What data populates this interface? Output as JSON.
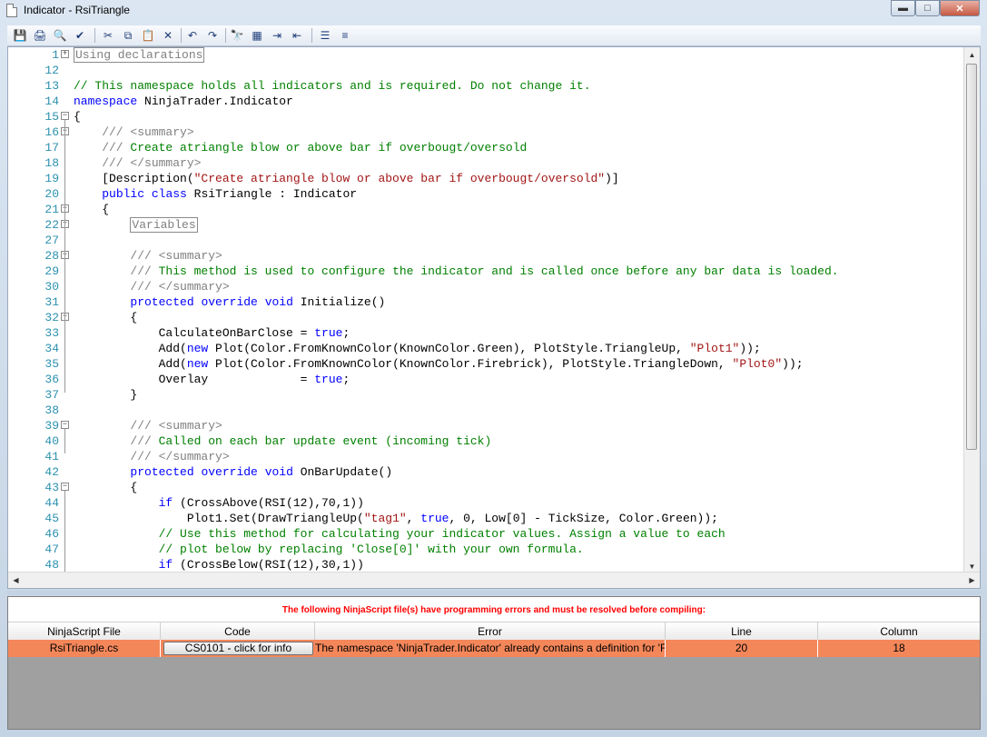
{
  "window": {
    "title": "Indicator - RsiTriangle",
    "controls": {
      "minimize": "▬",
      "maximize": "□",
      "close": "✕"
    }
  },
  "toolbar": {
    "icons": [
      "save-icon",
      "print-icon",
      "print-preview-icon",
      "compile-icon",
      "cut-icon",
      "copy-icon",
      "paste-icon",
      "delete-icon",
      "undo-icon",
      "redo-icon",
      "find-icon",
      "find-replace-icon",
      "indent-icon",
      "outdent-icon",
      "comment-icon",
      "uncomment-icon"
    ],
    "glyphs": [
      "💾",
      "🖨",
      "🔍",
      "✔",
      "✂",
      "⧉",
      "📋",
      "✕",
      "↶",
      "↷",
      "🔭",
      "▦",
      "⇥",
      "⇤",
      "☰",
      "≡"
    ]
  },
  "editor": {
    "lines": [
      {
        "num": "1",
        "fold": "plus"
      },
      {
        "num": "12"
      },
      {
        "num": "13"
      },
      {
        "num": "14"
      },
      {
        "num": "15",
        "fold": "minus"
      },
      {
        "num": "16",
        "fold": "minus"
      },
      {
        "num": "17"
      },
      {
        "num": "18",
        "fold": "end"
      },
      {
        "num": "19"
      },
      {
        "num": "20"
      },
      {
        "num": "21",
        "fold": "minus"
      },
      {
        "num": "22",
        "fold": "plus"
      },
      {
        "num": "27"
      },
      {
        "num": "28",
        "fold": "minus"
      },
      {
        "num": "29"
      },
      {
        "num": "30",
        "fold": "end"
      },
      {
        "num": "31"
      },
      {
        "num": "32",
        "fold": "minus"
      },
      {
        "num": "33"
      },
      {
        "num": "34"
      },
      {
        "num": "35"
      },
      {
        "num": "36"
      },
      {
        "num": "37",
        "fold": "end"
      },
      {
        "num": "38"
      },
      {
        "num": "39",
        "fold": "minus"
      },
      {
        "num": "40"
      },
      {
        "num": "41",
        "fold": "end"
      },
      {
        "num": "42"
      },
      {
        "num": "43",
        "fold": "minus"
      },
      {
        "num": "44"
      },
      {
        "num": "45"
      },
      {
        "num": "46"
      },
      {
        "num": "47"
      },
      {
        "num": "48"
      }
    ],
    "code": {
      "l1": "Using declarations",
      "l13": "// This namespace holds all indicators and is required. Do not change it.",
      "l14_kw": "namespace",
      "l14_rest": " NinjaTrader.Indicator",
      "l15": "{",
      "l16a": "    /// <summary>",
      "l17a": "    /// ",
      "l17b": "Create atriangle blow or above bar if overbougt/oversold",
      "l18a": "    /// </summary>",
      "l19a": "    [Description(",
      "l19b": "\"Create atriangle blow or above bar if overbougt/oversold\"",
      "l19c": ")]",
      "l20a": "public",
      "l20b": "class",
      "l20c": " RsiTriangle : Indicator",
      "l21": "    {",
      "l22": "Variables",
      "l28": "        /// <summary>",
      "l29a": "        /// ",
      "l29b": "This method is used to configure the indicator and is called once before any bar data is loaded.",
      "l30": "        /// </summary>",
      "l31a": "protected",
      "l31b": "override",
      "l31c": "void",
      "l31d": " Initialize()",
      "l32": "        {",
      "l33a": "            CalculateOnBarClose = ",
      "l33b": "true",
      "l33c": ";",
      "l34a": "            Add(",
      "l34b": "new",
      "l34c": " Plot(Color.FromKnownColor(KnownColor.Green), PlotStyle.TriangleUp, ",
      "l34d": "\"Plot1\"",
      "l34e": "));",
      "l35a": "            Add(",
      "l35b": "new",
      "l35c": " Plot(Color.FromKnownColor(KnownColor.Firebrick), PlotStyle.TriangleDown, ",
      "l35d": "\"Plot0\"",
      "l35e": "));",
      "l36a": "            Overlay             = ",
      "l36b": "true",
      "l36c": ";",
      "l37": "        }",
      "l39": "        /// <summary>",
      "l40a": "        /// ",
      "l40b": "Called on each bar update event (incoming tick)",
      "l41": "        /// </summary>",
      "l42a": "protected",
      "l42b": "override",
      "l42c": "void",
      "l42d": " OnBarUpdate()",
      "l43": "        {",
      "l44a": "if",
      "l44b": " (CrossAbove(RSI(12),70,1))",
      "l45a": "                Plot1.Set(DrawTriangleUp(",
      "l45b": "\"tag1\"",
      "l45c": ", ",
      "l45d": "true",
      "l45e": ", 0, Low[0] - TickSize, Color.Green));",
      "l46": "            // Use this method for calculating your indicator values. Assign a value to each",
      "l47": "            // plot below by replacing 'Close[0]' with your own formula.",
      "l48a": "if",
      "l48b": " (CrossBelow(RSI(12),30,1))"
    }
  },
  "errors": {
    "message": "The following NinjaScript file(s) have programming errors and must be resolved before compiling:",
    "columns": [
      "NinjaScript File",
      "Code",
      "Error",
      "Line",
      "Column"
    ],
    "rows": [
      {
        "file": "RsiTriangle.cs",
        "code": "CS0101 - click for info",
        "error": "The namespace 'NinjaTrader.Indicator' already contains a definition for 'Rsi",
        "line": "20",
        "column": "18"
      }
    ]
  }
}
